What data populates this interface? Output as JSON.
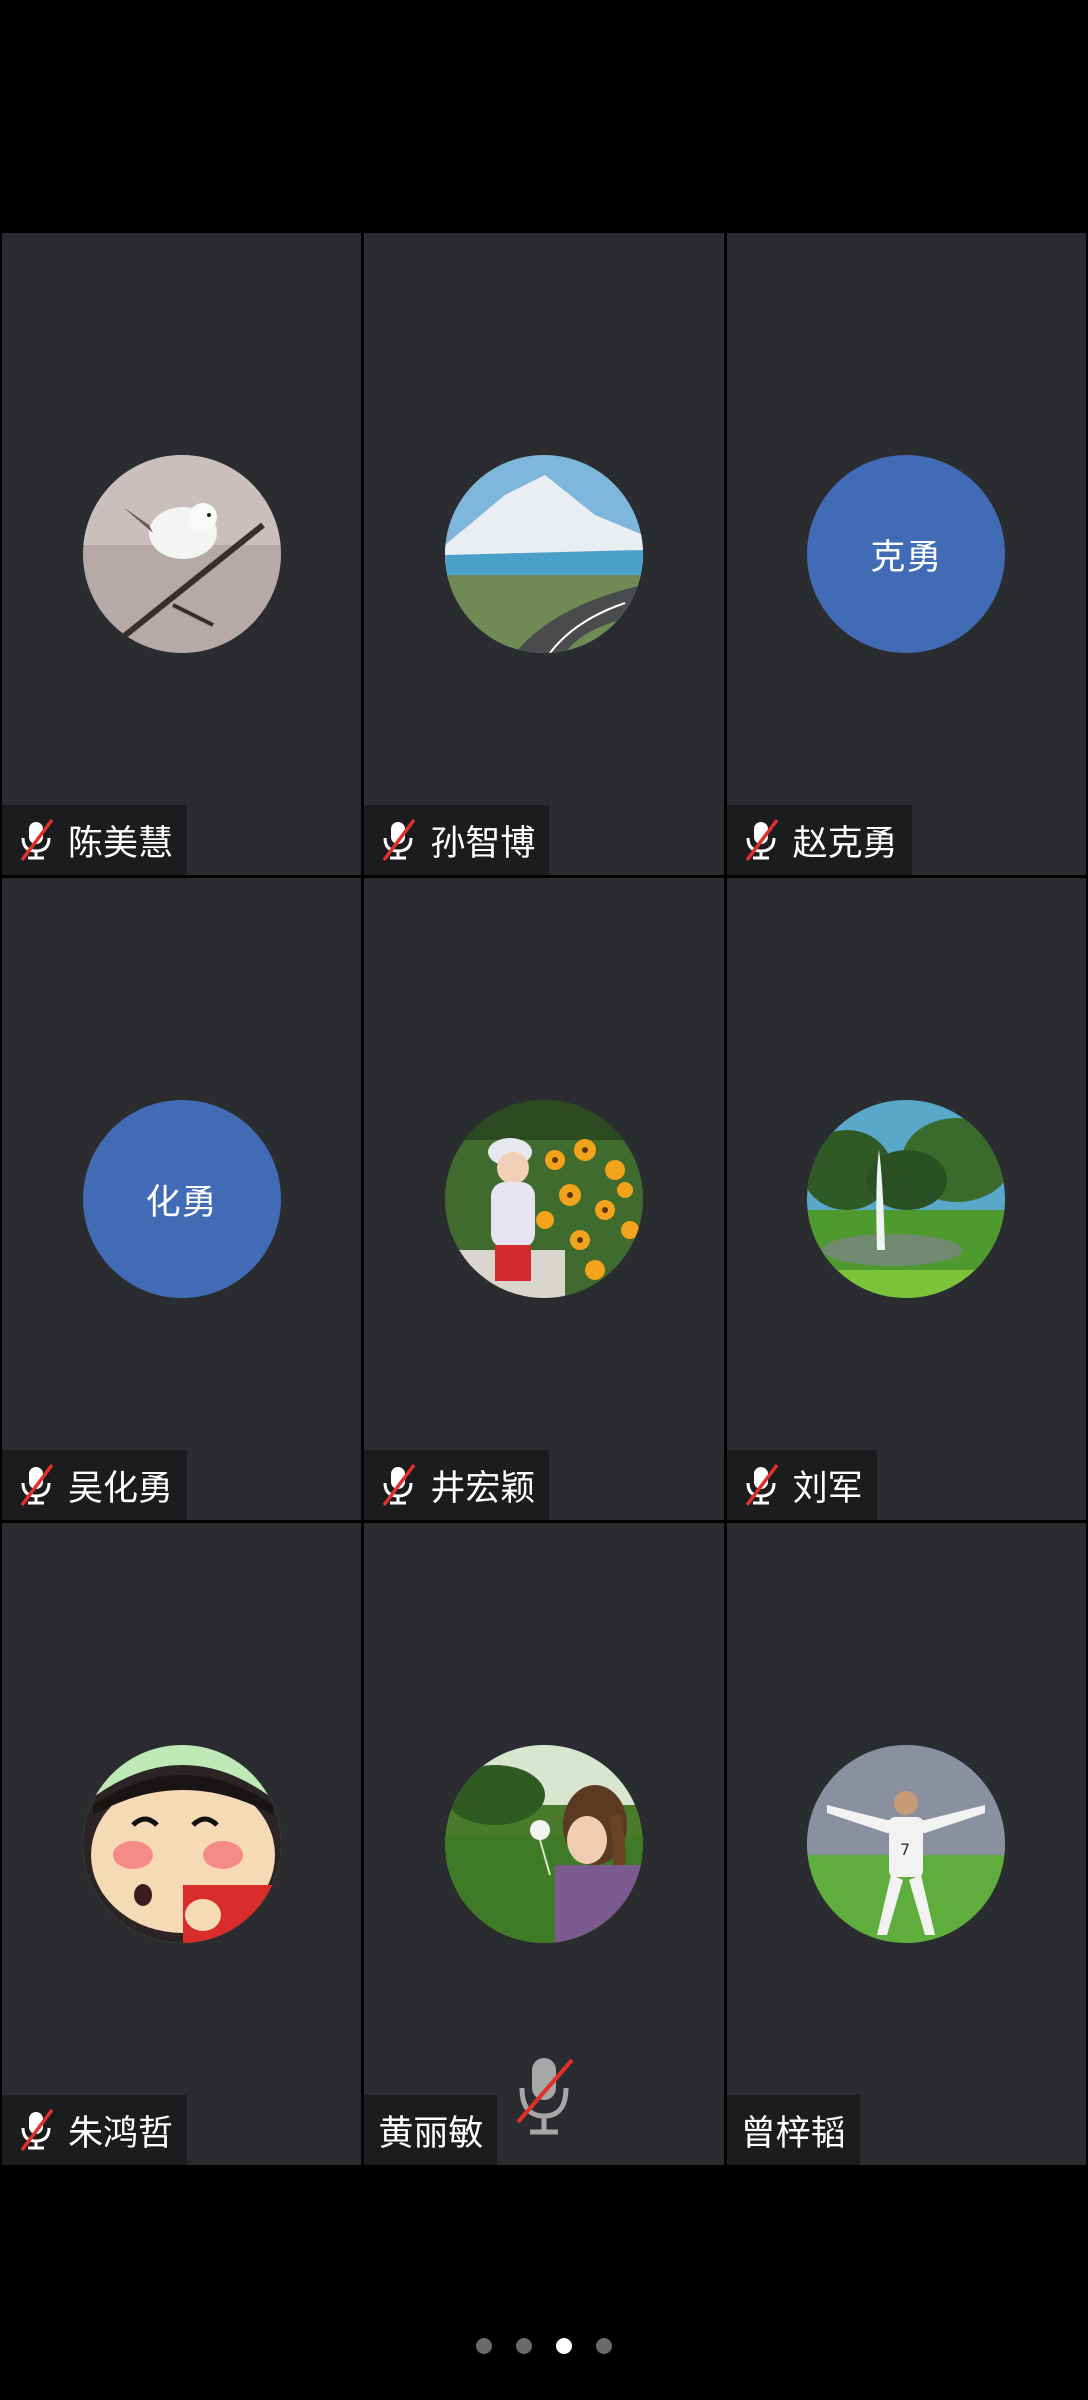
{
  "participants": [
    {
      "name": "陈美慧",
      "avatar": "bird-photo",
      "muted": true
    },
    {
      "name": "孙智博",
      "avatar": "mountain-road-photo",
      "muted": true
    },
    {
      "name": "赵克勇",
      "avatar_text": "克勇",
      "muted": true
    },
    {
      "name": "吴化勇",
      "avatar_text": "化勇",
      "muted": true
    },
    {
      "name": "井宏颖",
      "avatar": "child-flowers-photo",
      "muted": true
    },
    {
      "name": "刘军",
      "avatar": "fountain-park-photo",
      "muted": true
    },
    {
      "name": "朱鸿哲",
      "avatar": "cartoon-boy-photo",
      "muted": true
    },
    {
      "name": "黄丽敏",
      "avatar": "girl-dandelion-photo",
      "muted": false
    },
    {
      "name": "曾梓韬",
      "avatar": "footballer-photo",
      "muted": false
    }
  ],
  "overlay": {
    "icon": "microphone-muted-icon"
  },
  "pager": {
    "total": 4,
    "active_index": 2
  },
  "colors": {
    "tile_bg": "#2a2c2f",
    "text_avatar_bg": "#416bb5",
    "mute_red": "#e0302a",
    "page_bg": "#000000"
  }
}
